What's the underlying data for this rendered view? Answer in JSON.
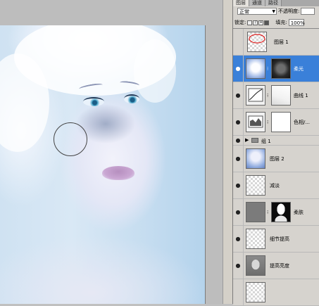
{
  "panel": {
    "tabs": [
      "图层",
      "通道",
      "路径"
    ],
    "blend_mode": "正常",
    "opacity_label": "不透明度:",
    "opacity_value": "",
    "lock_label": "锁定:",
    "fill_label": "填充:",
    "fill_value": "100%",
    "layers": [
      {
        "name": "图层 1"
      },
      {
        "name": "柔光"
      },
      {
        "name": "曲线 1"
      },
      {
        "name": "色相/..."
      },
      {
        "name": "组 1"
      },
      {
        "name": "图层 2"
      },
      {
        "name": "减淡"
      },
      {
        "name": "柔肤"
      },
      {
        "name": "细节提高"
      },
      {
        "name": "提高亮度"
      }
    ]
  }
}
